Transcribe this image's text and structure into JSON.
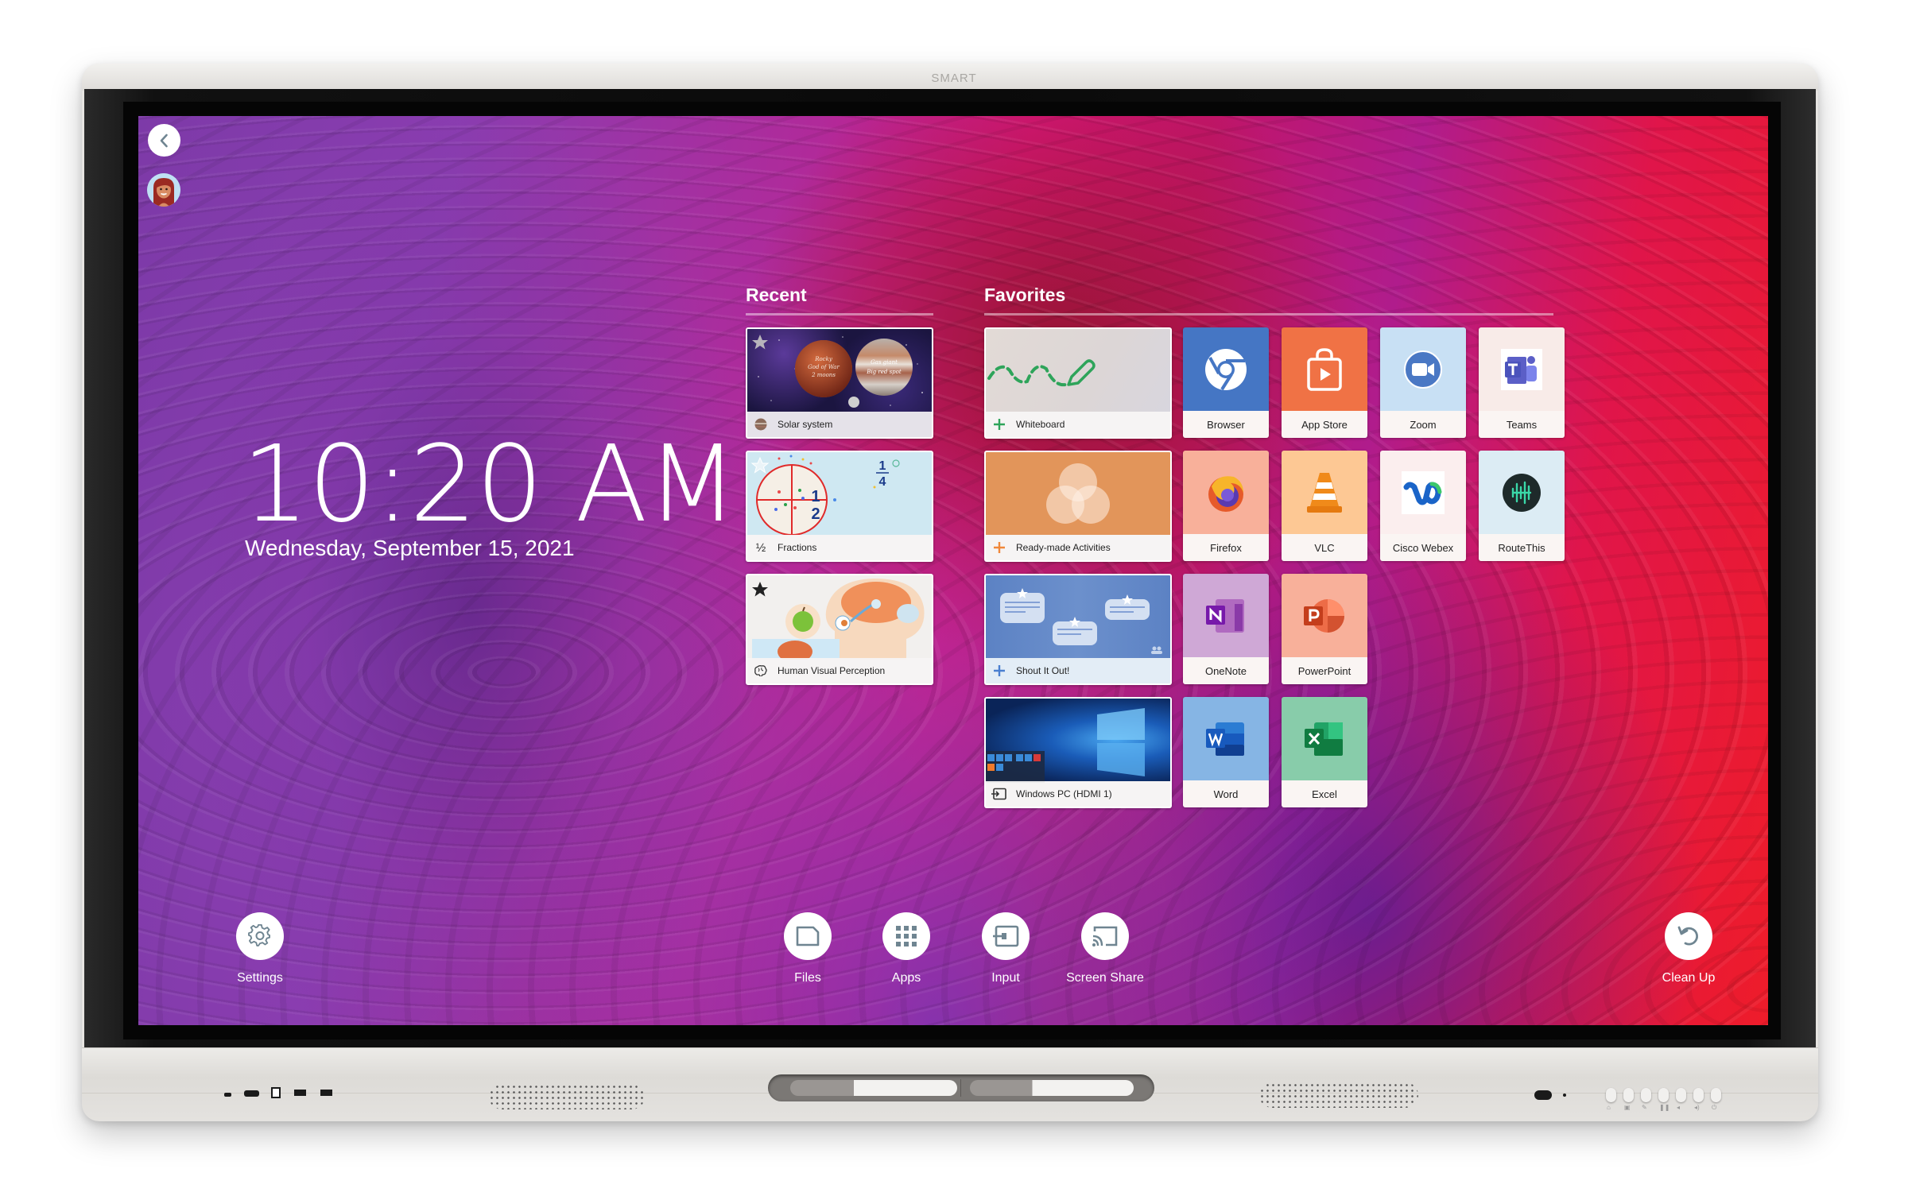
{
  "device": {
    "brand_logo": "SMART"
  },
  "top_left": {
    "back_icon": "chevron-left-icon",
    "avatar_icon": "user-avatar"
  },
  "clock": {
    "time": "10:20 AM",
    "date": "Wednesday, September 15, 2021"
  },
  "recent": {
    "title": "Recent",
    "items": [
      {
        "label": "Solar system",
        "icon": "planet-icon",
        "starred": true,
        "thumb_text": [
          "Rocky",
          "God of War",
          "2 moons",
          "Gas giant",
          "Big red spot"
        ]
      },
      {
        "label": "Fractions",
        "icon": "fraction-icon",
        "icon_glyph": "½",
        "starred": true,
        "thumb_text": [
          "1",
          "4",
          "1",
          "2"
        ]
      },
      {
        "label": "Human Visual Perception",
        "icon": "brain-icon",
        "starred": true
      }
    ]
  },
  "favorites": {
    "title": "Favorites",
    "wide_items": [
      {
        "label": "Whiteboard",
        "icon": "plus-icon",
        "accent": "#2ea45a"
      },
      {
        "label": "Ready-made Activities",
        "icon": "plus-icon",
        "accent": "#f0883a"
      },
      {
        "label": "Shout It Out!",
        "icon": "plus-icon",
        "accent": "#4a7fd0"
      },
      {
        "label": "Windows PC (HDMI 1)",
        "icon": "input-icon",
        "accent": "#333333"
      }
    ],
    "apps": [
      {
        "label": "Browser",
        "icon": "chrome-icon",
        "bg": "#4576c4"
      },
      {
        "label": "App Store",
        "icon": "shopping-bag-icon",
        "bg": "#f07245"
      },
      {
        "label": "Zoom",
        "icon": "zoom-camera-icon",
        "bg": "#c8e0f4"
      },
      {
        "label": "Teams",
        "icon": "teams-icon",
        "bg": "#f8ebe8"
      },
      {
        "label": "Firefox",
        "icon": "firefox-icon",
        "bg": "#f8b09a"
      },
      {
        "label": "VLC",
        "icon": "vlc-cone-icon",
        "bg": "#fdc894"
      },
      {
        "label": "Cisco Webex",
        "icon": "webex-icon",
        "bg": "#fbeeee"
      },
      {
        "label": "RouteThis",
        "icon": "routethis-icon",
        "bg": "#dcecf4"
      },
      {
        "label": "OneNote",
        "icon": "onenote-icon",
        "bg": "#cfa8d6"
      },
      {
        "label": "PowerPoint",
        "icon": "powerpoint-icon",
        "bg": "#f8b09a"
      },
      {
        "label": "Word",
        "icon": "word-icon",
        "bg": "#86b5e4"
      },
      {
        "label": "Excel",
        "icon": "excel-icon",
        "bg": "#88ccaa"
      }
    ]
  },
  "dock": {
    "settings": {
      "label": "Settings",
      "icon": "gear-icon"
    },
    "files": {
      "label": "Files",
      "icon": "file-icon"
    },
    "apps": {
      "label": "Apps",
      "icon": "grid-icon"
    },
    "input": {
      "label": "Input",
      "icon": "input-icon"
    },
    "screen_share": {
      "label": "Screen Share",
      "icon": "cast-icon"
    },
    "clean_up": {
      "label": "Clean Up",
      "icon": "undo-icon"
    }
  },
  "hardware": {
    "front_buttons": [
      "home-icon",
      "input-icon",
      "pen-icon",
      "freeze-icon",
      "volume-down-icon",
      "volume-up-icon",
      "power-icon"
    ]
  },
  "colors": {
    "icon_gray": "#6f8591",
    "wallpaper_red": "#ee1c2a",
    "wallpaper_magenta": "#d8177f",
    "wallpaper_purple": "#7d3aa8"
  }
}
